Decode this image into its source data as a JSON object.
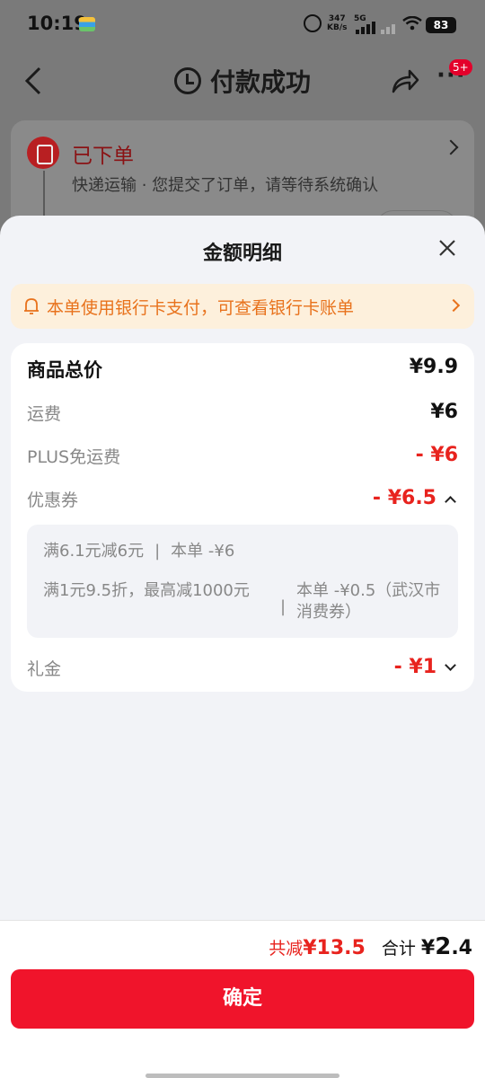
{
  "status_bar": {
    "time": "10:19",
    "speed_value": "347",
    "speed_unit": "KB/s",
    "network": "5G",
    "battery": "83"
  },
  "background_page": {
    "title": "付款成功",
    "badge": "5+",
    "order_status": "已下单",
    "order_desc": "快递运输 · 您提交了订单，请等待系统确认"
  },
  "sheet": {
    "title": "金额明细",
    "notice": "本单使用银行卡支付，可查看银行卡账单",
    "rows": {
      "total": {
        "label": "商品总价",
        "value": "¥9.9"
      },
      "shipping": {
        "label": "运费",
        "value": "¥6"
      },
      "plus": {
        "label": "PLUS免运费",
        "value": "- ¥6"
      },
      "coupon": {
        "label": "优惠券",
        "value": "- ¥6.5"
      },
      "gift": {
        "label": "礼金",
        "value": "- ¥1"
      }
    },
    "coupon_details": [
      {
        "rule": "满6.1元减6元",
        "saving": "本单 -¥6"
      },
      {
        "rule": "满1元9.5折，最高减1000元",
        "saving": "本单 -¥0.5（武汉市消费券）"
      }
    ]
  },
  "footer": {
    "saved_label": "共减",
    "saved_value": "¥13.5",
    "total_label": "合计",
    "total_symbol": "¥",
    "total_int": "2",
    "total_dec": ".4",
    "confirm_label": "确定"
  },
  "colors": {
    "accent_red": "#f0142b",
    "price_red": "#e8231e",
    "notice_orange": "#e8721c",
    "notice_bg": "#fdf0dc"
  },
  "icons": [
    "back-icon",
    "clock-icon",
    "share-icon",
    "more-icon",
    "order-icon",
    "close-icon",
    "bell-icon",
    "chevron-right-icon",
    "chevron-up-icon",
    "chevron-down-icon"
  ]
}
